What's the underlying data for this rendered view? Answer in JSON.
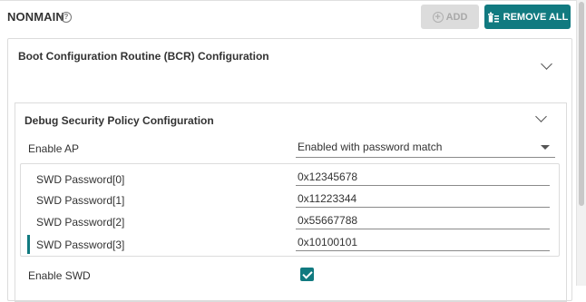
{
  "header": {
    "title": "NONMAIN",
    "help_icon": "?",
    "add_label": "ADD",
    "remove_all_label": "REMOVE ALL"
  },
  "bcr": {
    "title": "Boot Configuration Routine (BCR) Configuration"
  },
  "debug": {
    "title": "Debug Security Policy Configuration",
    "enable_ap_label": "Enable AP",
    "enable_ap_value": "Enabled with password match",
    "passwords": [
      {
        "label": "SWD Password[0]",
        "value": "0x12345678"
      },
      {
        "label": "SWD Password[1]",
        "value": "0x11223344"
      },
      {
        "label": "SWD Password[2]",
        "value": "0x55667788"
      },
      {
        "label": "SWD Password[3]",
        "value": "0x10100101"
      }
    ],
    "enable_swd_label": "Enable SWD",
    "enable_swd_checked": true
  },
  "colors": {
    "accent": "#117a80",
    "disabled_button": "#dcdcdc"
  }
}
